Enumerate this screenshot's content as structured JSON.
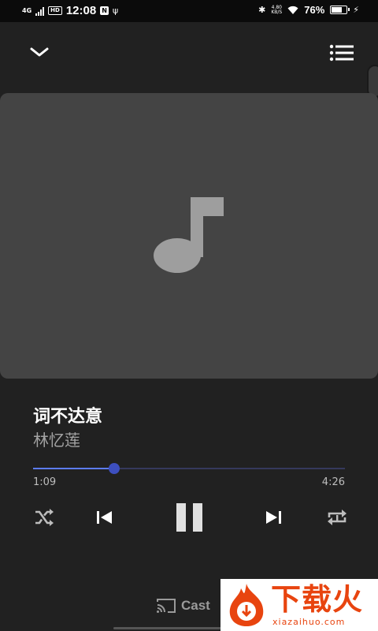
{
  "status_bar": {
    "network": "4G",
    "hd": "HD",
    "time": "12:08",
    "nfc": "N",
    "speed_value": "4.80",
    "speed_unit": "KB/S",
    "battery_percent": "76%",
    "battery_level": 0.76
  },
  "now_playing": {
    "title": "词不达意",
    "artist": "林忆莲",
    "elapsed": "1:09",
    "duration": "4:26",
    "progress": 0.26
  },
  "controls": {
    "shuffle": "shuffle-icon",
    "previous": "skip-previous-icon",
    "play_pause": "pause-icon",
    "next": "skip-next-icon",
    "repeat": "repeat-one-icon"
  },
  "cast": {
    "label": "Cast"
  },
  "watermark": {
    "text": "下载火",
    "url": "xiazaihuo.com"
  },
  "colors": {
    "background": "#212121",
    "artwork": "#444444",
    "accent": "#3d4fbf",
    "progress": "#5c7cfa",
    "watermark": "#e8440f"
  }
}
